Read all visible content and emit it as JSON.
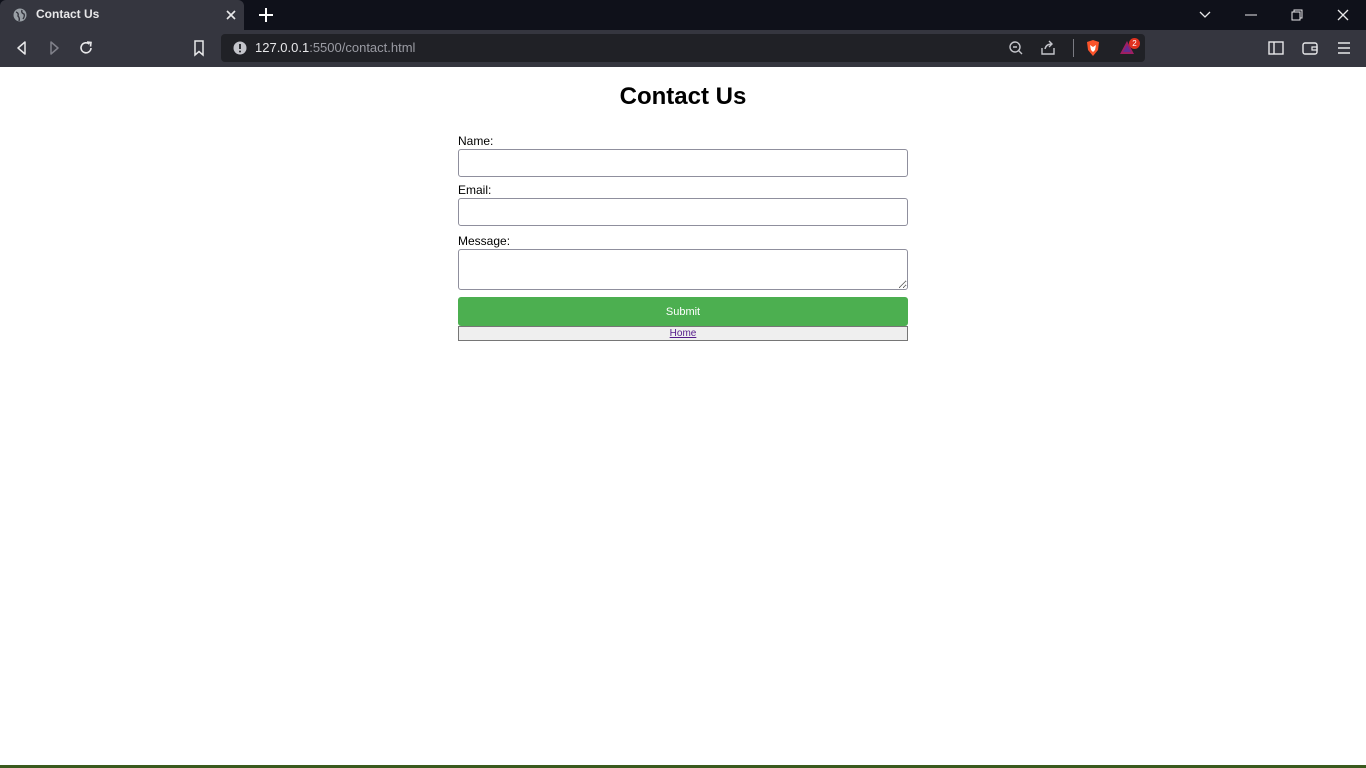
{
  "browser": {
    "tab_title": "Contact Us",
    "url_host": "127.0.0.1",
    "url_rest": ":5500/contact.html",
    "notification_count": "2"
  },
  "page": {
    "title": "Contact Us",
    "form": {
      "name_label": "Name:",
      "name_value": "",
      "email_label": "Email:",
      "email_value": "",
      "message_label": "Message:",
      "message_value": "",
      "submit_label": "Submit",
      "home_link": "Home"
    }
  },
  "colors": {
    "submit_bg": "#4caf50",
    "link": "#551a8b",
    "chrome_dark": "#0f111a",
    "chrome_tab": "#35363f"
  }
}
